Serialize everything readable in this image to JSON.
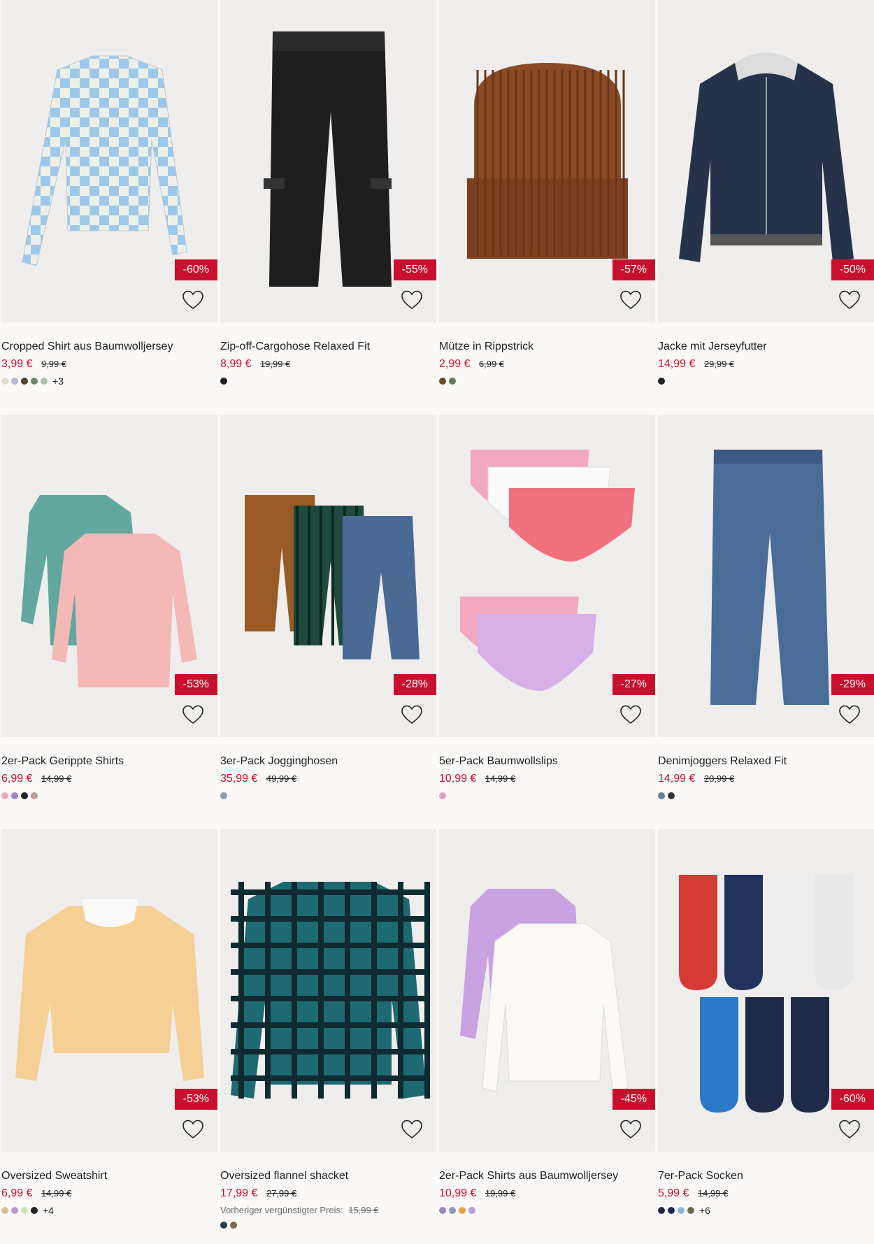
{
  "products": [
    {
      "title": "Cropped Shirt aus Baumwolljersey",
      "price": "3,99 €",
      "old_price": "9,99 €",
      "discount": "-60%",
      "swatches": [
        "#e8dcc8",
        "#b9b6d6",
        "#5a4030",
        "#6b8a6b",
        "#a9c4a9"
      ],
      "more": "+3",
      "bg": "#efeeec",
      "art": "shirt-check-blue"
    },
    {
      "title": "Zip-off-Cargohose Relaxed Fit",
      "price": "8,99 €",
      "old_price": "19,99 €",
      "discount": "-55%",
      "swatches": [
        "#222222"
      ],
      "more": "",
      "bg": "#efeeec",
      "art": "pants-black"
    },
    {
      "title": "Mütze in Rippstrick",
      "price": "2,99 €",
      "old_price": "6,99 €",
      "discount": "-57%",
      "swatches": [
        "#6b4a2a",
        "#5f7a5f"
      ],
      "more": "",
      "bg": "#efeeec",
      "art": "beanie-brown"
    },
    {
      "title": "Jacke mit Jerseyfutter",
      "price": "14,99 €",
      "old_price": "29,99 €",
      "discount": "-50%",
      "swatches": [
        "#222222"
      ],
      "more": "",
      "bg": "#efeeec",
      "art": "jacket-navy"
    },
    {
      "title": "2er-Pack Gerippte Shirts",
      "price": "6,99 €",
      "old_price": "14,99 €",
      "discount": "-53%",
      "swatches": [
        "#f0a6b6",
        "#9e86c0",
        "#222222",
        "#c09a9a"
      ],
      "more": "",
      "bg": "#efeeec",
      "art": "shirts-teal-pink"
    },
    {
      "title": "3er-Pack Jogginghosen",
      "price": "35,99 €",
      "old_price": "49,99 €",
      "discount": "-28%",
      "swatches": [
        "#8a9ab8"
      ],
      "more": "",
      "bg": "#efeeec",
      "art": "pants-three"
    },
    {
      "title": "5er-Pack Baumwollslips",
      "price": "10,99 €",
      "old_price": "14,99 €",
      "discount": "-27%",
      "swatches": [
        "#e8a0c8"
      ],
      "more": "",
      "bg": "#efeeec",
      "art": "slips-pink"
    },
    {
      "title": "Denimjoggers Relaxed Fit",
      "price": "14,99 €",
      "old_price": "20,99 €",
      "discount": "-29%",
      "swatches": [
        "#6b7ba0",
        "#333333"
      ],
      "more": "",
      "bg": "#efeeec",
      "art": "jeans-blue"
    },
    {
      "title": "Oversized Sweatshirt",
      "price": "6,99 €",
      "old_price": "14,99 €",
      "discount": "-53%",
      "swatches": [
        "#d6c098",
        "#b79ad0",
        "#cfe8b0",
        "#222222"
      ],
      "more": "+4",
      "bg": "#efeeec",
      "art": "sweat-peach"
    },
    {
      "title": "Oversized flannel shacket",
      "price": "17,99 €",
      "old_price": "27,99 €",
      "discount": "",
      "prev_label": "Vorheriger vergünstigter Preis:",
      "prev_price": "15,99 €",
      "swatches": [
        "#2a3a4a",
        "#7a6a4a"
      ],
      "more": "",
      "bg": "#efeeec",
      "art": "flannel-teal"
    },
    {
      "title": "2er-Pack Shirts aus Baumwolljersey",
      "price": "10,99 €",
      "old_price": "19,99 €",
      "discount": "-45%",
      "swatches": [
        "#9e86c0",
        "#8a9ab8",
        "#e8a040",
        "#b9a0d8"
      ],
      "more": "",
      "bg": "#efeeec",
      "art": "shirts-lilac-white"
    },
    {
      "title": "7er-Pack Socken",
      "price": "5,99 €",
      "old_price": "14,99 €",
      "discount": "-60%",
      "swatches": [
        "#222a3a",
        "#1a2a5a",
        "#8ab8d8",
        "#6b6a4a"
      ],
      "more": "+6",
      "bg": "#efeeec",
      "art": "socks-spiderman"
    }
  ]
}
